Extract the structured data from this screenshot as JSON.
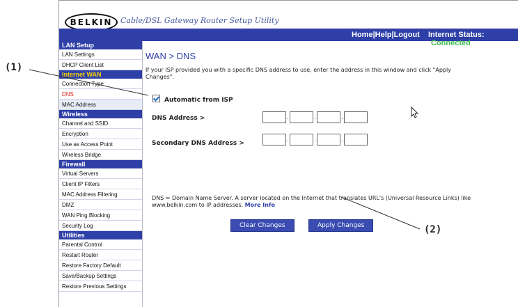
{
  "header": {
    "logo_text": "BELKIN",
    "logo_registered": "®",
    "utility_title": "Cable/DSL Gateway Router Setup Utility",
    "links": [
      "Home",
      "Help",
      "Logout"
    ],
    "status_label": "Internet Status:",
    "status_value": "Connected"
  },
  "sidebar": {
    "sections": [
      {
        "title": "LAN Setup",
        "items": [
          "LAN Settings",
          "DHCP Client List"
        ]
      },
      {
        "title": "Internet WAN",
        "items": [
          "Connection Type",
          "DNS",
          "MAC Address"
        ]
      },
      {
        "title": "Wireless",
        "items": [
          "Channel and SSID",
          "Encryption",
          "Use as Access Point",
          "Wireless Bridge"
        ]
      },
      {
        "title": "Firewall",
        "items": [
          "Virtual Servers",
          "Client IP Filters",
          "MAC Address Filtering",
          "DMZ",
          "WAN Ping Blocking",
          "Security Log"
        ]
      },
      {
        "title": "Utilities",
        "items": [
          "Parental Control",
          "Restart Router",
          "Restore Factory Default",
          "Save/Backup Settings",
          "Restore Previous Settings"
        ]
      }
    ],
    "active_section": "Internet WAN",
    "active_item": "DNS"
  },
  "main": {
    "title": "WAN > DNS",
    "intro": "If your ISP provided you with a specific DNS address to use, enter the address in this window and click \"Apply Changes\".",
    "auto_label": "Automatic from ISP",
    "auto_checked": true,
    "dns_label": "DNS Address >",
    "secondary_label": "Secondary DNS Address >",
    "dns_values": [
      "",
      "",
      "",
      ""
    ],
    "secondary_values": [
      "",
      "",
      "",
      ""
    ],
    "description": "DNS = Domain Name Server. A server located on the Internet that translates URL's (Universal Resource Links) like www.belkin.com to IP addresses.",
    "more_info": "More Info",
    "clear_button": "Clear Changes",
    "apply_button": "Apply Changes"
  },
  "callouts": {
    "one": "(1)",
    "two": "(2)"
  },
  "colors": {
    "nav_blue": "#2e3fa7",
    "active_section_yellow": "#f5d400",
    "active_item_red": "#e0281c",
    "status_green": "#3dbb50"
  }
}
